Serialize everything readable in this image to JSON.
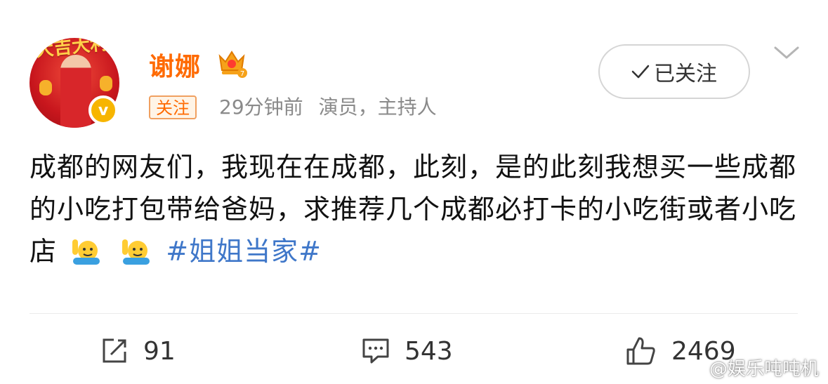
{
  "user": {
    "name": "谢娜",
    "follow_tag": "关注",
    "time_ago": "29分钟前",
    "description": "演员，主持人",
    "avatar_banner": "大吉大利",
    "verified_mark": "v"
  },
  "follow_button": {
    "label": "已关注",
    "check_icon": "check-icon"
  },
  "post": {
    "text": "成都的网友们，我现在在成都，此刻，是的此刻我想买一些成都的小吃打包带给爸妈，求推荐几个成都必打卡的小吃街或者小吃店",
    "hashtag": "#姐姐当家#"
  },
  "actions": {
    "repost_count": "91",
    "comment_count": "543",
    "like_count": "2469"
  },
  "watermark": {
    "text": "@娱乐吨吨机",
    "icon": "weibo-logo-icon"
  },
  "colors": {
    "username": "#ff6a00",
    "hashtag": "#3f77c9",
    "meta": "#8a8a8a",
    "verified": "#f7b500"
  }
}
